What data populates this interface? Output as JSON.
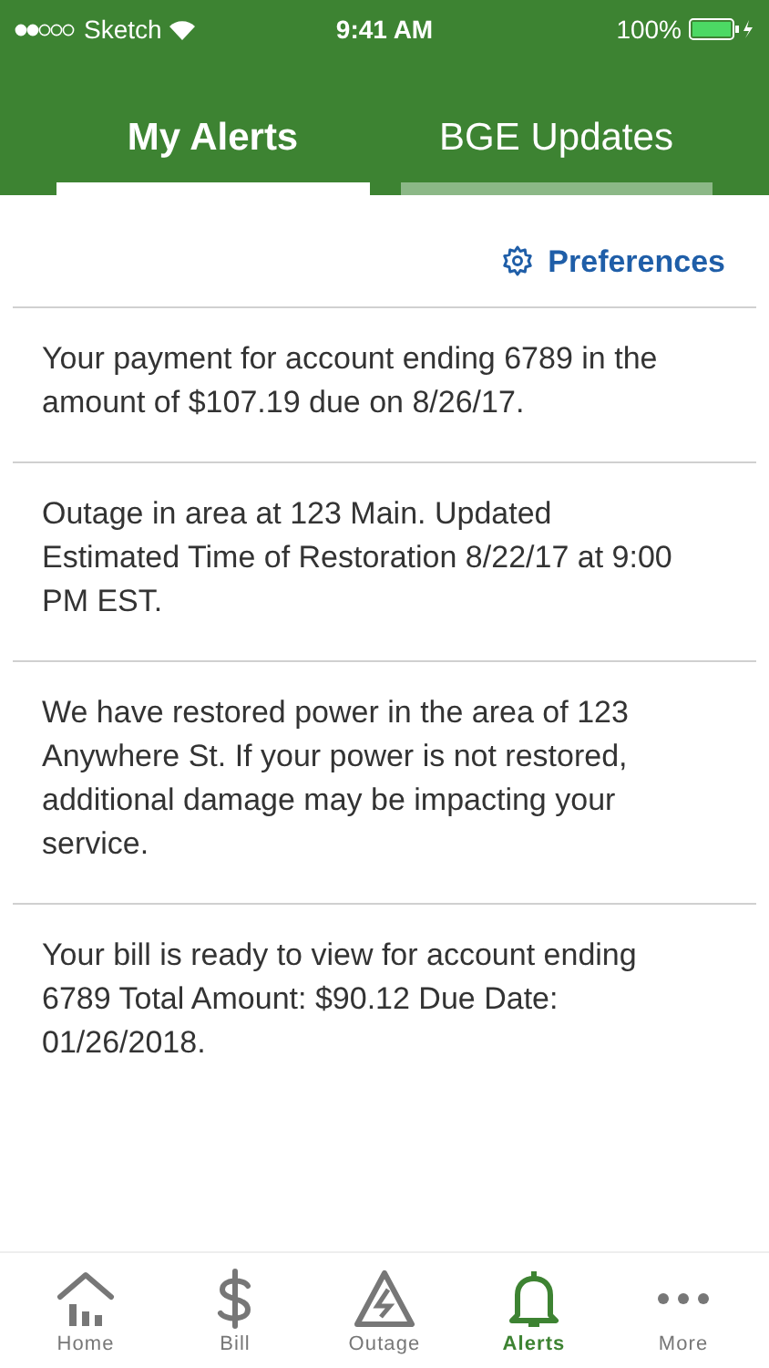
{
  "status_bar": {
    "carrier": "Sketch",
    "time": "9:41 AM",
    "battery": "100%"
  },
  "tabs": [
    {
      "label": "My Alerts",
      "selected": true
    },
    {
      "label": "BGE Updates",
      "selected": false
    }
  ],
  "preferences": {
    "label": "Preferences"
  },
  "alerts": [
    "Your payment for account ending 6789 in the amount of $107.19 due on 8/26/17.",
    "Outage in area at 123 Main. Updated Estimated Time of Restoration 8/22/17 at 9:00 PM EST.",
    "We have restored power in the area of 123 Anywhere St. If your power is not restored, additional damage may be impacting your service.",
    "Your bill is ready to view for account ending 6789 Total Amount: $90.12 Due Date: 01/26/2018."
  ],
  "nav": [
    {
      "kind": "home",
      "label": "Home",
      "selected": false
    },
    {
      "kind": "bill",
      "label": "Bill",
      "selected": false
    },
    {
      "kind": "outage",
      "label": "Outage",
      "selected": false
    },
    {
      "kind": "alerts",
      "label": "Alerts",
      "selected": true
    },
    {
      "kind": "more",
      "label": "More",
      "selected": false
    }
  ]
}
